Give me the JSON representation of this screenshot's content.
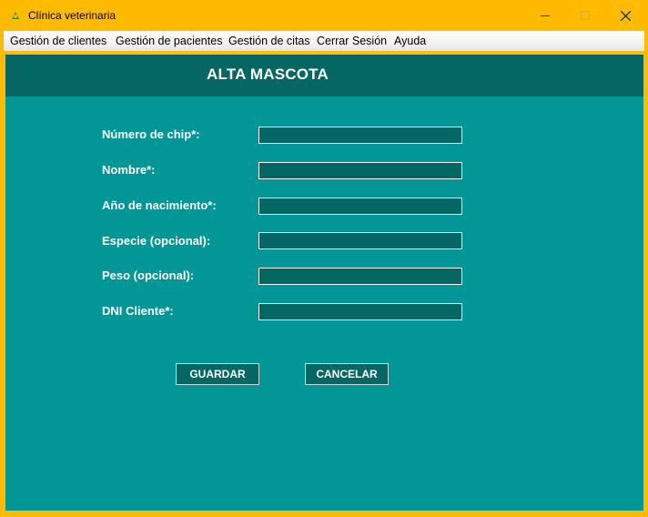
{
  "window": {
    "title": "Clínica veterinaria",
    "icon": "leaf-paw-icon"
  },
  "menu": {
    "items": [
      {
        "label": "Gestión de clientes"
      },
      {
        "label": "Gestión de pacientes"
      },
      {
        "label": "Gestión de citas"
      },
      {
        "label": "Cerrar Sesión"
      },
      {
        "label": "Ayuda"
      }
    ]
  },
  "form": {
    "title": "ALTA MASCOTA",
    "fields": [
      {
        "label": "Número de chip*:",
        "value": ""
      },
      {
        "label": "Nombre*:",
        "value": ""
      },
      {
        "label": "Año de nacimiento*:",
        "value": ""
      },
      {
        "label": "Especie (opcional):",
        "value": ""
      },
      {
        "label": "Peso (opcional):",
        "value": ""
      },
      {
        "label": "DNI Cliente*:",
        "value": ""
      }
    ],
    "buttons": {
      "save": "GUARDAR",
      "cancel": "CANCELAR"
    }
  },
  "colors": {
    "titlebar": "#ffbb00",
    "background": "#039696",
    "header": "#056764",
    "input": "#056764",
    "text": "#ffffff"
  }
}
